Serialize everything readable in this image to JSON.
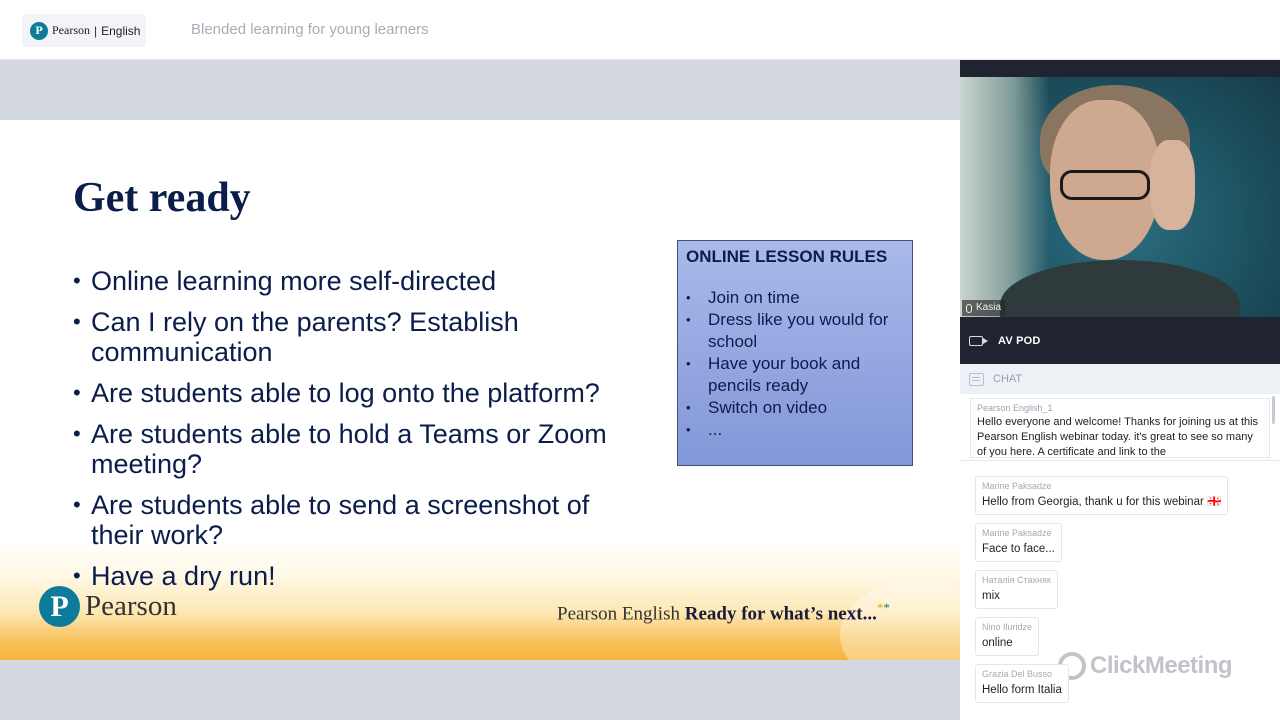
{
  "header": {
    "brand": {
      "mark": "P",
      "name": "Pearson",
      "separator": "|",
      "sub": "English"
    },
    "event_title": "Blended learning for young learners"
  },
  "slide": {
    "title": "Get ready",
    "bullets": [
      "Online learning more self-directed",
      "Can I rely on the parents? Establish communication",
      "Are students able to log onto the platform?",
      "Are students able to hold a Teams or Zoom meeting?",
      "Are students able to send a screenshot of their work?",
      "Have a dry run!"
    ],
    "rules_box": {
      "title": "ONLINE LESSON RULES",
      "items": [
        "Join on time",
        "Dress like you would for school",
        "Have your book and pencils ready",
        "Switch on video",
        "..."
      ]
    },
    "footer": {
      "logo_mark": "P",
      "logo_word": "Pearson",
      "tagline_regular": "Pearson English",
      "tagline_bold": "Ready for what’s next...",
      "tagline_star_gold": "*",
      "tagline_star_teal": "*"
    }
  },
  "video": {
    "presenter_name": "Kasia"
  },
  "av_pod": {
    "label": "AV POD",
    "icon": "camera-icon"
  },
  "chat": {
    "label": "CHAT",
    "icon": "chat-icon",
    "pinned": {
      "author": "Pearson English_1",
      "text": "Hello everyone and welcome! Thanks for joining us at this Pearson English webinar today. it's great to see so many of you here. A certificate and link to the"
    },
    "messages": [
      {
        "author": "Marine Paksadze",
        "text": "Hello from Georgia, thank u for this webinar 🇬🇪"
      },
      {
        "author": "Marine Paksadze",
        "text": "Face to face..."
      },
      {
        "author": "Наталія Стахняк",
        "text": "mix"
      },
      {
        "author": "Nino Iluridze",
        "text": "online"
      },
      {
        "author": "Grazia Del Busso",
        "text": "Hello form Italia"
      }
    ],
    "watermark": "ClickMeeting"
  },
  "colors": {
    "slide_title": "#0b1d4a",
    "pearson_teal": "#0d7c9a",
    "rules_box": "#8297d8",
    "panel_dark": "#1f2430"
  }
}
